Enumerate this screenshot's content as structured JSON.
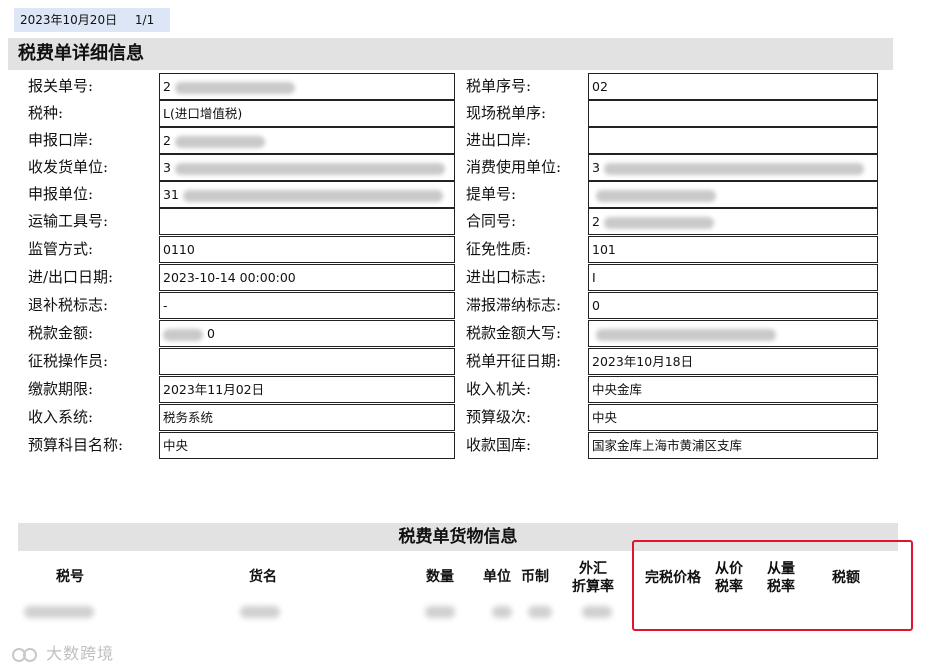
{
  "header": {
    "date": "2023年10月20日",
    "page": "1/1"
  },
  "title": "税费单详细信息",
  "left_fields": [
    {
      "label": "报关单号:",
      "value": "2"
    },
    {
      "label": "税种:",
      "value": "L(进口增值税)"
    },
    {
      "label": "申报口岸:",
      "value": "2"
    },
    {
      "label": "收发货单位:",
      "value": "3"
    },
    {
      "label": "申报单位:",
      "value": "31"
    },
    {
      "label": "运输工具号:",
      "value": ""
    },
    {
      "label": "监管方式:",
      "value": "0110"
    },
    {
      "label": "进/出口日期:",
      "value": "2023-10-14 00:00:00"
    },
    {
      "label": "退补税标志:",
      "value": "-"
    },
    {
      "label": "税款金额:",
      "value": "0"
    },
    {
      "label": "征税操作员:",
      "value": ""
    },
    {
      "label": "缴款期限:",
      "value": "2023年11月02日"
    },
    {
      "label": "收入系统:",
      "value": "税务系统"
    },
    {
      "label": "预算科目名称:",
      "value": "中央"
    }
  ],
  "right_fields": [
    {
      "label": "税单序号:",
      "value": "02"
    },
    {
      "label": "现场税单序:",
      "value": ""
    },
    {
      "label": "进出口岸:",
      "value": ""
    },
    {
      "label": "消费使用单位:",
      "value": "3"
    },
    {
      "label": "提单号:",
      "value": ""
    },
    {
      "label": "合同号:",
      "value": "2"
    },
    {
      "label": "征免性质:",
      "value": "101"
    },
    {
      "label": "进出口标志:",
      "value": "I"
    },
    {
      "label": "滞报滞纳标志:",
      "value": "0"
    },
    {
      "label": "税款金额大写:",
      "value": ""
    },
    {
      "label": "税单开征日期:",
      "value": "2023年10月18日"
    },
    {
      "label": "收入机关:",
      "value": "中央金库"
    },
    {
      "label": "预算级次:",
      "value": "中央"
    },
    {
      "label": "收款国库:",
      "value": "国家金库上海市黄浦区支库"
    }
  ],
  "goods": {
    "title": "税费单货物信息",
    "columns": {
      "tax_no": "税号",
      "goods_name": "货名",
      "quantity": "数量",
      "unit": "单位",
      "currency": "币制",
      "fx_1": "外汇",
      "fx_2": "折算率",
      "dutiable_price": "完税价格",
      "ad_valorem_1": "从价",
      "ad_valorem_2": "税率",
      "specific_1": "从量",
      "specific_2": "税率",
      "tax_amount": "税额"
    }
  },
  "watermark": "大数跨境",
  "colors": {
    "highlight_box": "#e0142c",
    "date_bar": "#dde6f6",
    "section_bg": "#e2e2e2"
  }
}
